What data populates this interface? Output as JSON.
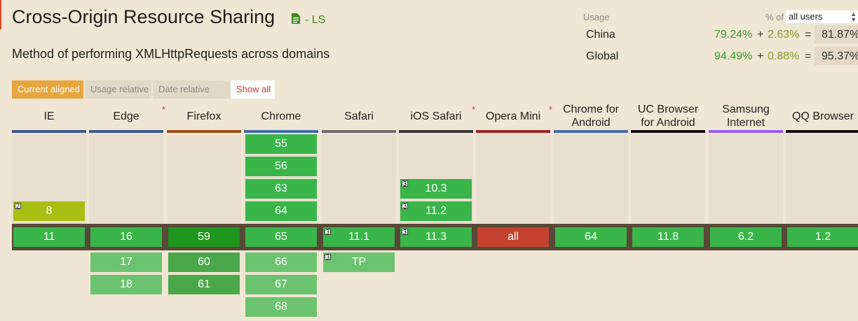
{
  "feature": {
    "title": "Cross-Origin Resource Sharing",
    "status": "- LS",
    "status_icon": "document-icon",
    "description": "Method of performing XMLHttpRequests across domains"
  },
  "usage": {
    "label": "Usage",
    "pct_of_label": "% of",
    "selected_users": "all users",
    "rows": [
      {
        "region": "China",
        "full": "79.24%",
        "plus": "+",
        "partial": "2.63%",
        "eq": "=",
        "total": "81.87%"
      },
      {
        "region": "Global",
        "full": "94.49%",
        "plus": "+",
        "partial": "0.88%",
        "eq": "=",
        "total": "95.37%"
      }
    ]
  },
  "view_buttons": {
    "current": "Current aligned",
    "usage": "Usage relative",
    "date": "Date relative",
    "show_all": "Show all"
  },
  "colors": {
    "supported": "#39b54a",
    "supported_future": "#6cc36f",
    "partial": "#a8be13",
    "unsupported": "#c44230",
    "firefox_current": "#1e951c",
    "firefox_future": "#4aa84a",
    "accent": "#e7a640"
  },
  "browsers": [
    {
      "name": "IE",
      "asterisk": "",
      "bar_color": "#395a8c",
      "past": [
        {
          "v": "8",
          "note": "2",
          "status": "partial"
        }
      ],
      "current": {
        "v": "11",
        "note": "",
        "status": "supported"
      },
      "future": []
    },
    {
      "name": "Edge",
      "asterisk": "*",
      "bar_color": "#395a8c",
      "past": [],
      "current": {
        "v": "16",
        "note": "",
        "status": "supported"
      },
      "future": [
        {
          "v": "17",
          "note": ""
        },
        {
          "v": "18",
          "note": ""
        }
      ]
    },
    {
      "name": "Firefox",
      "asterisk": "",
      "bar_color": "#9b4e1b",
      "past": [],
      "current": {
        "v": "59",
        "note": "",
        "status": "firefox"
      },
      "future": [
        {
          "v": "60",
          "note": ""
        },
        {
          "v": "61",
          "note": ""
        }
      ]
    },
    {
      "name": "Chrome",
      "asterisk": "",
      "bar_color": "#436aa8",
      "past": [
        {
          "v": "55",
          "note": "",
          "status": "supported"
        },
        {
          "v": "56",
          "note": "",
          "status": "supported"
        },
        {
          "v": "63",
          "note": "",
          "status": "supported"
        },
        {
          "v": "64",
          "note": "",
          "status": "supported"
        }
      ],
      "current": {
        "v": "65",
        "note": "",
        "status": "supported"
      },
      "future": [
        {
          "v": "66",
          "note": ""
        },
        {
          "v": "67",
          "note": ""
        },
        {
          "v": "68",
          "note": ""
        }
      ]
    },
    {
      "name": "Safari",
      "asterisk": "",
      "bar_color": "#6b6b6b",
      "past": [],
      "current": {
        "v": "11.1",
        "note": "3",
        "status": "supported"
      },
      "future": [
        {
          "v": "TP",
          "note": "3"
        }
      ]
    },
    {
      "name": "iOS Safari",
      "asterisk": "*",
      "bar_color": "#3a3a3a",
      "past": [
        {
          "v": "10.3",
          "note": "3",
          "status": "supported"
        },
        {
          "v": "11.2",
          "note": "3",
          "status": "supported"
        }
      ],
      "current": {
        "v": "11.3",
        "note": "3",
        "status": "supported"
      },
      "future": []
    },
    {
      "name": "Opera Mini",
      "asterisk": "*",
      "bar_color": "#992424",
      "past": [],
      "current": {
        "v": "all",
        "note": "",
        "status": "unsupported"
      },
      "future": []
    },
    {
      "name": "Chrome for Android",
      "asterisk": "",
      "bar_color": "#436aa8",
      "past": [],
      "current": {
        "v": "64",
        "note": "",
        "status": "supported"
      },
      "future": []
    },
    {
      "name": "UC Browser for Android",
      "asterisk": "",
      "bar_color": "#111111",
      "past": [],
      "current": {
        "v": "11.8",
        "note": "",
        "status": "supported"
      },
      "future": []
    },
    {
      "name": "Samsung Internet",
      "asterisk": "",
      "bar_color": "#9b5cf0",
      "past": [],
      "current": {
        "v": "6.2",
        "note": "",
        "status": "supported"
      },
      "future": []
    },
    {
      "name": "QQ Browser",
      "asterisk": "",
      "bar_color": "#111111",
      "past": [],
      "current": {
        "v": "1.2",
        "note": "",
        "status": "supported"
      },
      "future": []
    }
  ]
}
